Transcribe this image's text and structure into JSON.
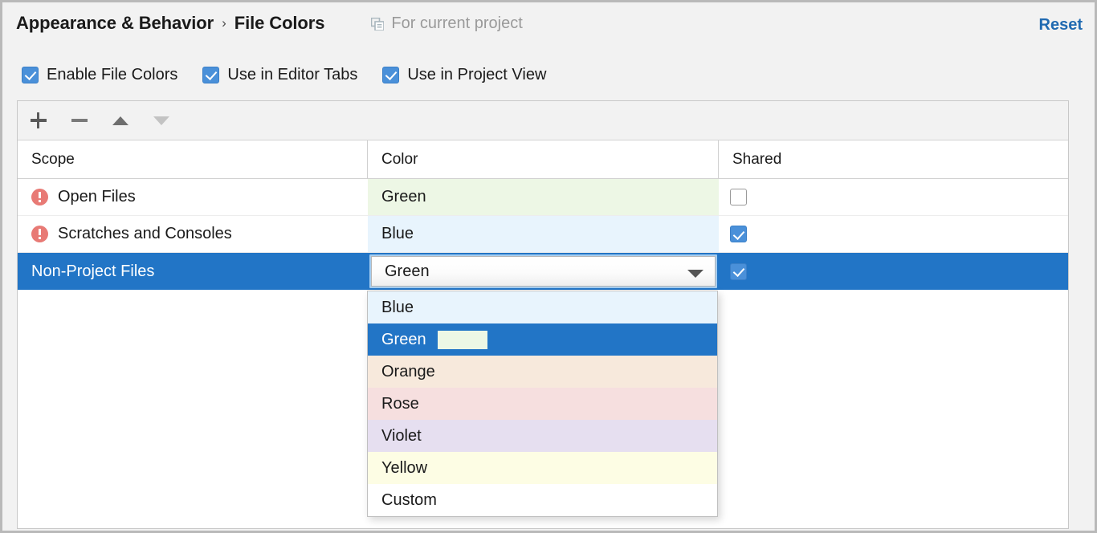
{
  "header": {
    "breadcrumb": [
      "Appearance & Behavior",
      "File Colors"
    ],
    "separator": "›",
    "scope_icon": "copy-documents-icon",
    "scope_label": "For current project",
    "reset_label": "Reset",
    "reset_color": "#206ab1"
  },
  "options_row": {
    "checkboxes": [
      {
        "label": "Enable File Colors",
        "checked": true
      },
      {
        "label": "Use in Editor Tabs",
        "checked": true
      },
      {
        "label": "Use in Project View",
        "checked": true
      }
    ],
    "checked_color": "#4a90d9"
  },
  "toolbar": {
    "buttons": [
      {
        "name": "add-button",
        "icon": "plus-icon",
        "enabled": true
      },
      {
        "name": "remove-button",
        "icon": "minus-icon",
        "enabled": true
      },
      {
        "name": "move-up-button",
        "icon": "triangle-up-icon",
        "enabled": true
      },
      {
        "name": "move-down-button",
        "icon": "triangle-down-icon",
        "enabled": false
      }
    ]
  },
  "table": {
    "columns": [
      "Scope",
      "Color",
      "Shared"
    ],
    "rows": [
      {
        "scope": "Open Files",
        "has_warning": true,
        "color": "Green",
        "color_bg": "#edf7e5",
        "shared": false,
        "selected": false,
        "editing": false
      },
      {
        "scope": "Scratches and Consoles",
        "has_warning": true,
        "color": "Blue",
        "color_bg": "#e8f4fd",
        "shared": true,
        "selected": false,
        "editing": false
      },
      {
        "scope": "Non-Project Files",
        "has_warning": false,
        "color": "Green",
        "color_bg": "#ffffff",
        "shared": true,
        "selected": true,
        "editing": true
      }
    ],
    "selection_color": "#2275c6"
  },
  "dropdown": {
    "open": true,
    "selected_value": "Green",
    "items": [
      {
        "label": "Blue",
        "bg": "#e8f4fd",
        "highlighted": false,
        "swatch": null
      },
      {
        "label": "Green",
        "bg": "#edf7e5",
        "highlighted": true,
        "swatch": "#edf7e5"
      },
      {
        "label": "Orange",
        "bg": "#f7e9dc",
        "highlighted": false,
        "swatch": null
      },
      {
        "label": "Rose",
        "bg": "#f6dfdf",
        "highlighted": false,
        "swatch": null
      },
      {
        "label": "Violet",
        "bg": "#e6dff0",
        "highlighted": false,
        "swatch": null
      },
      {
        "label": "Yellow",
        "bg": "#fdfde4",
        "highlighted": false,
        "swatch": null
      },
      {
        "label": "Custom",
        "bg": "#ffffff",
        "highlighted": false,
        "swatch": null
      }
    ]
  }
}
